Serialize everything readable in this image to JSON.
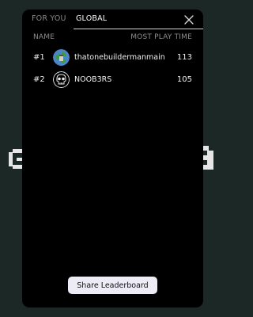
{
  "colors": {
    "page_bg": "#1b2826",
    "modal_bg": "#000000",
    "active_tab": "#ffffff",
    "inactive_tab": "#8a8a8a",
    "button_bg": "#ecebf6"
  },
  "tabs": [
    {
      "label": "FOR YOU",
      "active": false
    },
    {
      "label": "GLOBAL",
      "active": true
    }
  ],
  "close_icon": "close-icon",
  "table": {
    "columns": {
      "name": "NAME",
      "time": "MOST PLAY TIME"
    },
    "rows": [
      {
        "rank": "#1",
        "username": "thatonebuildermanmain",
        "value": "113",
        "avatar_icon": "globe-avatar-icon"
      },
      {
        "rank": "#2",
        "username": "NOOB3RS",
        "value": "105",
        "avatar_icon": "skull-avatar-icon"
      }
    ]
  },
  "share_button": {
    "label": "Share Leaderboard"
  }
}
